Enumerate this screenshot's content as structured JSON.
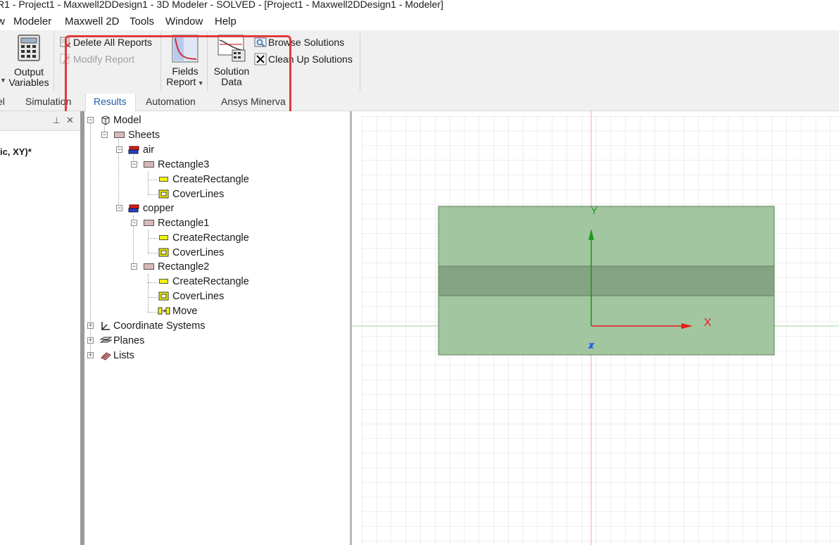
{
  "window": {
    "title": "R1 - Project1 - Maxwell2DDesign1 - 3D Modeler - SOLVED - [Project1 - Maxwell2DDesign1 - Modeler]"
  },
  "menu": {
    "items": [
      "w",
      "Modeler",
      "Maxwell 2D",
      "Tools",
      "Window",
      "Help"
    ]
  },
  "ribbon": {
    "output_variables": [
      "Output",
      "Variables"
    ],
    "delete_all_reports": "Delete All Reports",
    "modify_report": "Modify Report",
    "fields_report": [
      "Fields",
      "Report"
    ],
    "solution_data": [
      "Solution",
      "Data"
    ],
    "browse_solutions": "Browse Solutions",
    "clean_up_solutions": "Clean Up Solutions"
  },
  "tabs": [
    "el",
    "Simulation",
    "Results",
    "Automation",
    "Ansys Minerva"
  ],
  "active_tab": "Results",
  "left_panel": {
    "partial_label": "ic, XY)*",
    "pin_glyph": "⊥",
    "close_glyph": "✕"
  },
  "tree": {
    "model": "Model",
    "sheets": "Sheets",
    "air": "air",
    "rectangle3": "Rectangle3",
    "create_rectangle": "CreateRectangle",
    "cover_lines": "CoverLines",
    "copper": "copper",
    "rectangle1": "Rectangle1",
    "rectangle2": "Rectangle2",
    "move": "Move",
    "coordinate_systems": "Coordinate Systems",
    "planes": "Planes",
    "lists": "Lists"
  },
  "viewport": {
    "axis_x": "X",
    "axis_y": "Y",
    "colors": {
      "outer_rect": "#a2c6a0",
      "inner_strip": "#85a483",
      "x_axis": "#e81c1c",
      "y_axis": "#1e9a1e",
      "z_axis": "#1e5ee8",
      "grid": "#dcdcdc",
      "highlight": "#e23a3a"
    }
  }
}
